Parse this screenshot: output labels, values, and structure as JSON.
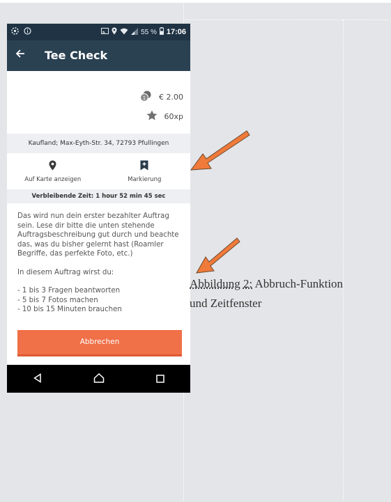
{
  "statusbar": {
    "battery": "55 %",
    "time": "17:06"
  },
  "appbar": {
    "title": "Tee Check"
  },
  "reward": {
    "price": "€ 2.00",
    "xp": "60xp"
  },
  "address": "Kaufland; Max-Eyth-Str. 34, 72793 Pfullingen",
  "actions": {
    "map_label": "Auf Karte anzeigen",
    "bookmark_label": "Markierung"
  },
  "remaining_time": "Verbleibende Zeit: 1 hour 52 min 45 sec",
  "description": {
    "paragraph": "Das wird nun dein erster bezahlter Auftrag sein. Lese dir bitte die unten stehende Auftragsbeschreibung gut durch und beachte das, was du bisher gelernt hast (Roamler Begriffe, das perfekte Foto, etc.)",
    "intro": "In diesem Auftrag wirst du:",
    "items": [
      "- 1 bis 3 Fragen beantworten",
      "- 5 bis 7 Fotos machen",
      "- 10 bis 15 Minuten brauchen"
    ]
  },
  "cancel_button": "Abbrechen",
  "caption": {
    "label": "Abbildung 2:",
    "text": " Abbruch-Funktion und Zeitfenster"
  },
  "colors": {
    "appbar": "#2a4152",
    "button": "#f07048",
    "arrow": "#f07a3a"
  }
}
